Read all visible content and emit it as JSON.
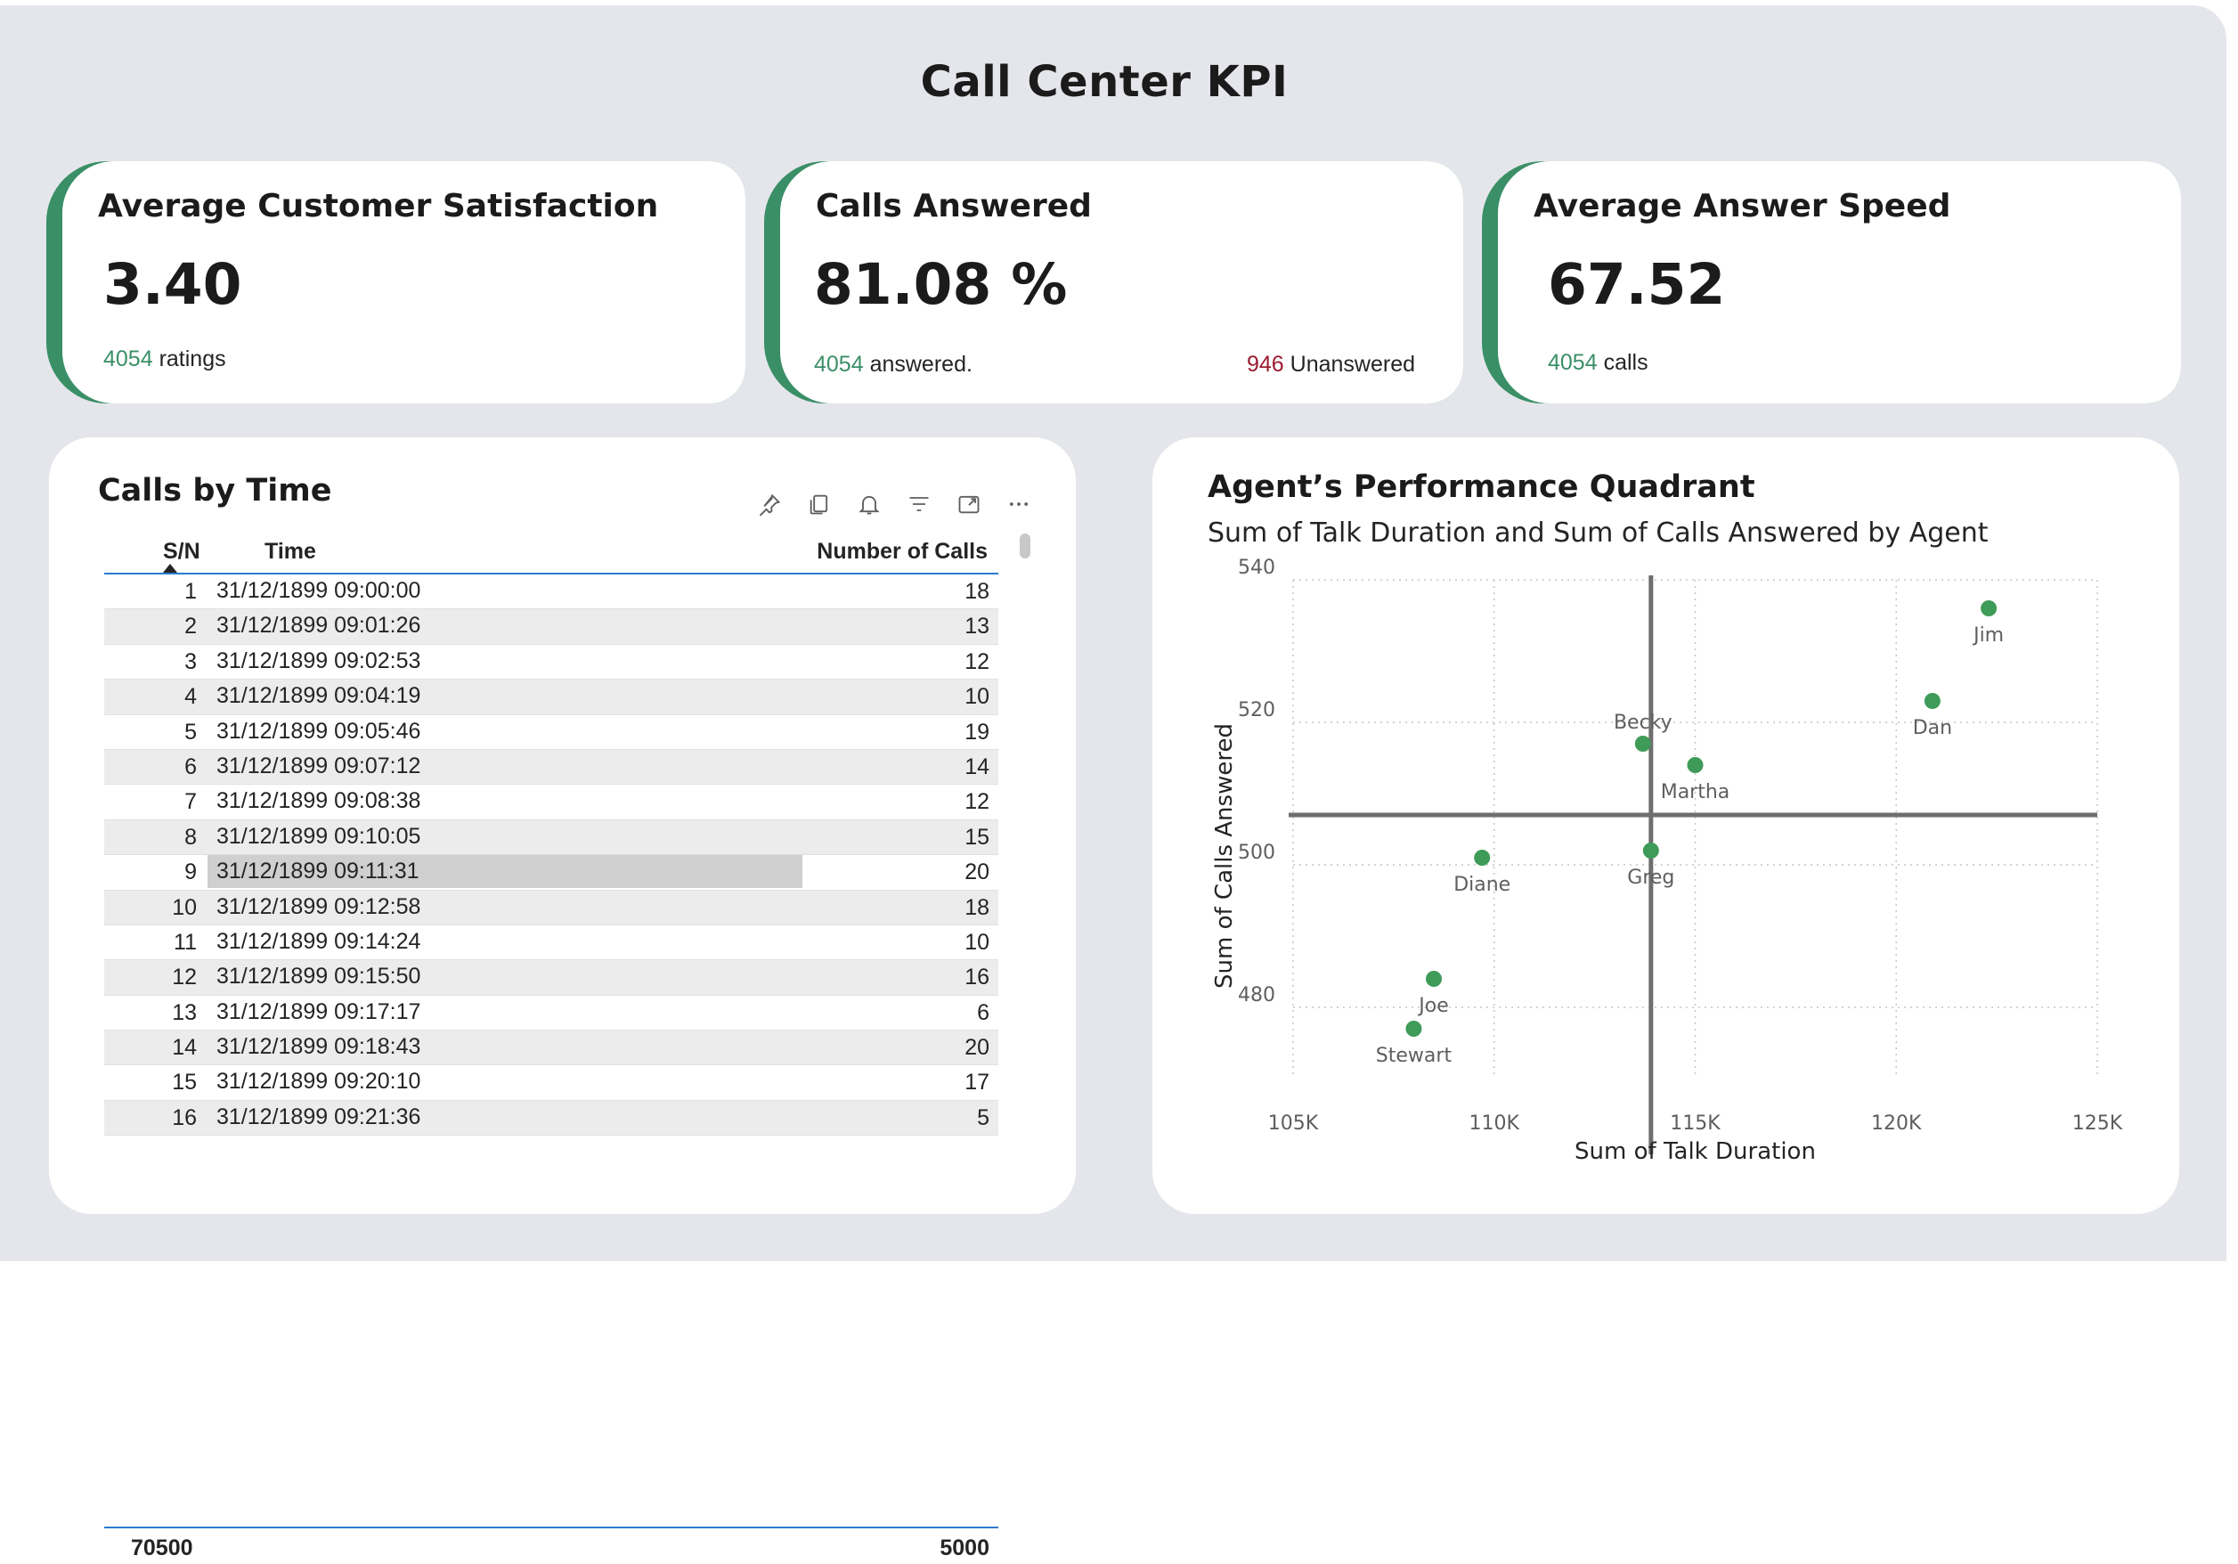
{
  "page_title": "Call Center KPI",
  "kpis": [
    {
      "label": "Average Customer Satisfaction",
      "value": "3.40",
      "count": "4054",
      "count_suffix": " ratings"
    },
    {
      "label": "Calls Answered",
      "value": "81.08 %",
      "count": "4054",
      "count_suffix": " answered.",
      "unanswered": "946",
      "unanswered_suffix": " Unanswered"
    },
    {
      "label": "Average Answer Speed",
      "value": "67.52",
      "count": "4054",
      "count_suffix": " calls"
    }
  ],
  "calls_table": {
    "title": "Calls by Time",
    "toolbar_icons": [
      "pin-icon",
      "copy-icon",
      "bell-icon",
      "filter-icon",
      "focus-mode-icon",
      "more-options-icon"
    ],
    "columns": [
      "S/N",
      "Time",
      "Number of Calls"
    ],
    "rows": [
      {
        "sn": "1",
        "time": "31/12/1899 09:00:00",
        "calls": "18"
      },
      {
        "sn": "2",
        "time": "31/12/1899 09:01:26",
        "calls": "13"
      },
      {
        "sn": "3",
        "time": "31/12/1899 09:02:53",
        "calls": "12"
      },
      {
        "sn": "4",
        "time": "31/12/1899 09:04:19",
        "calls": "10"
      },
      {
        "sn": "5",
        "time": "31/12/1899 09:05:46",
        "calls": "19"
      },
      {
        "sn": "6",
        "time": "31/12/1899 09:07:12",
        "calls": "14"
      },
      {
        "sn": "7",
        "time": "31/12/1899 09:08:38",
        "calls": "12"
      },
      {
        "sn": "8",
        "time": "31/12/1899 09:10:05",
        "calls": "15"
      },
      {
        "sn": "9",
        "time": "31/12/1899 09:11:31",
        "calls": "20"
      },
      {
        "sn": "10",
        "time": "31/12/1899 09:12:58",
        "calls": "18"
      },
      {
        "sn": "11",
        "time": "31/12/1899 09:14:24",
        "calls": "10"
      },
      {
        "sn": "12",
        "time": "31/12/1899 09:15:50",
        "calls": "16"
      },
      {
        "sn": "13",
        "time": "31/12/1899 09:17:17",
        "calls": "6"
      },
      {
        "sn": "14",
        "time": "31/12/1899 09:18:43",
        "calls": "20"
      },
      {
        "sn": "15",
        "time": "31/12/1899 09:20:10",
        "calls": "17"
      },
      {
        "sn": "16",
        "time": "31/12/1899 09:21:36",
        "calls": "5"
      }
    ],
    "selected_row": "9",
    "total_sn": "70500",
    "total_calls": "5000"
  },
  "chart_data": {
    "type": "scatter",
    "title": "Agent’s Performance Quadrant",
    "subtitle": "Sum of Talk Duration and Sum of Calls Answered by Agent",
    "xlabel": "Sum of Talk Duration",
    "ylabel": "Sum of Calls Answered",
    "xlim": [
      105000,
      125000
    ],
    "ylim": [
      470,
      540
    ],
    "x_ticks": [
      {
        "value": 105000,
        "label": "105K"
      },
      {
        "value": 110000,
        "label": "110K"
      },
      {
        "value": 115000,
        "label": "115K"
      },
      {
        "value": 120000,
        "label": "120K"
      },
      {
        "value": 125000,
        "label": "125K"
      }
    ],
    "y_ticks": [
      {
        "value": 480,
        "label": "480"
      },
      {
        "value": 500,
        "label": "500"
      },
      {
        "value": 520,
        "label": "520"
      },
      {
        "value": 540,
        "label": "540"
      }
    ],
    "grid": true,
    "reference_lines": {
      "x": 113900,
      "y": 507
    },
    "point_color": "#3f9b58",
    "points": [
      {
        "name": "Jim",
        "x": 122300,
        "y": 536,
        "label_pos": "below"
      },
      {
        "name": "Dan",
        "x": 120900,
        "y": 523,
        "label_pos": "below"
      },
      {
        "name": "Becky",
        "x": 113700,
        "y": 517,
        "label_pos": "above"
      },
      {
        "name": "Martha",
        "x": 115000,
        "y": 514,
        "label_pos": "below"
      },
      {
        "name": "Greg",
        "x": 113900,
        "y": 502,
        "label_pos": "below"
      },
      {
        "name": "Diane",
        "x": 109700,
        "y": 501,
        "label_pos": "below"
      },
      {
        "name": "Joe",
        "x": 108500,
        "y": 484,
        "label_pos": "below"
      },
      {
        "name": "Stewart",
        "x": 108000,
        "y": 477,
        "label_pos": "below"
      }
    ]
  },
  "colors": {
    "accent": "#3a8f67",
    "negative": "#9b1b30",
    "table_rule": "#2b7bd0",
    "background": "#e5e6eb"
  }
}
